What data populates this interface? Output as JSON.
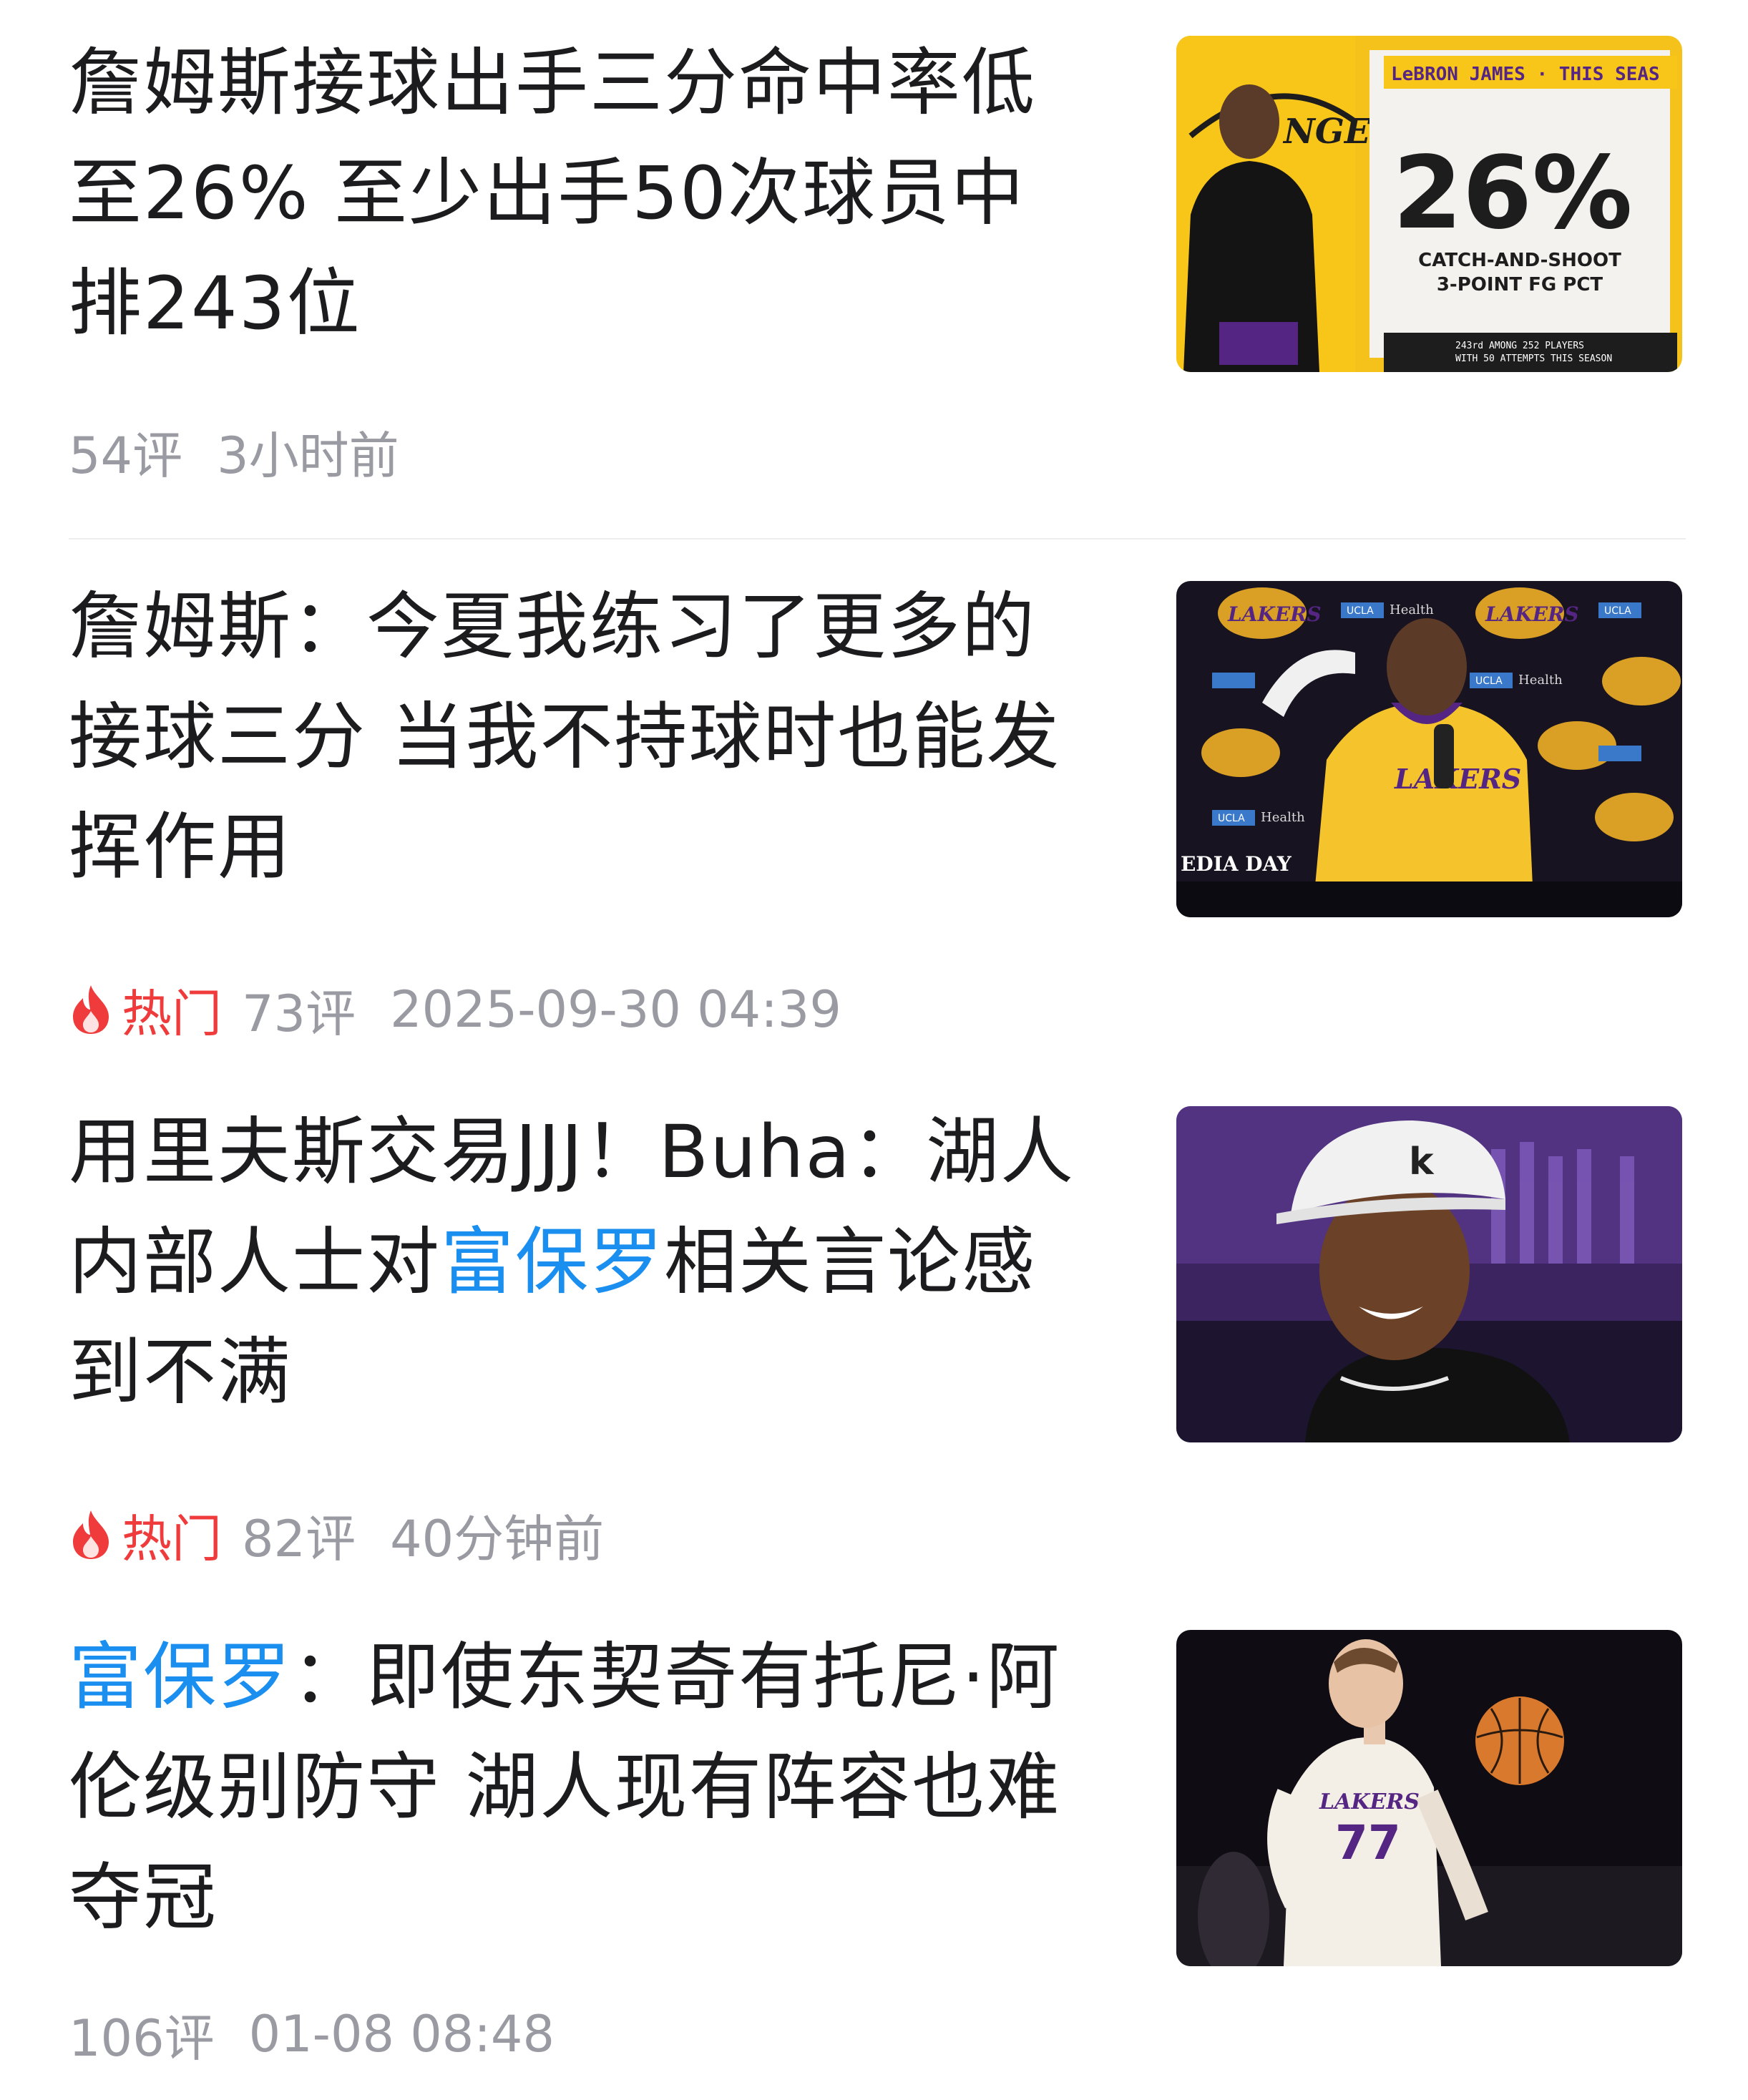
{
  "articles": [
    {
      "title_parts": [
        "詹姆斯接球出手三分命中率低至26% 至少出手50次球员中排243位"
      ],
      "comments": "54评",
      "time": "3小时前",
      "hot": false,
      "thumb": {
        "icon": "lebron-stat-graphic",
        "header": "LeBRON JAMES · THIS SEAS",
        "stat": "26%",
        "caption1": "CATCH-AND-SHOOT",
        "caption2": "3-POINT FG PCT",
        "footnote1": "243rd AMONG 252 PLAYERS",
        "footnote2": "WITH 50 ATTEMPTS THIS SEASON",
        "bg_text": "NGE"
      }
    },
    {
      "title_parts": [
        "詹姆斯：今夏我练习了更多的接球三分 当我不持球时也能发挥作用"
      ],
      "comments": "73评",
      "time": "2025-09-30 04:39",
      "hot": true,
      "hot_label": "热门",
      "thumb": {
        "icon": "media-day-photo",
        "logo_text": "LAKERS",
        "sponsor": "UCLA",
        "sponsor_sub": "Health",
        "jersey_text": "LAKERS",
        "footer_text": "EDIA DAY"
      }
    },
    {
      "title_parts": [
        "用里夫斯交易JJJ！Buha：湖人内部人士对",
        "富保罗",
        "相关言论感到不满"
      ],
      "highlight_index": 1,
      "comments": "82评",
      "time": "40分钟前",
      "hot": true,
      "hot_label": "热门",
      "thumb": {
        "icon": "courtside-portrait-photo",
        "cap_letter": "k"
      }
    },
    {
      "title_parts": [
        "",
        "富保罗",
        "：即使东契奇有托尼·阿伦级别防守 湖人现有阵容也难夺冠"
      ],
      "highlight_index": 1,
      "comments": "106评",
      "time": "01-08 08:48",
      "hot": false,
      "thumb": {
        "icon": "player-dribbling-photo",
        "jersey_text": "LAKERS",
        "number": "77"
      }
    }
  ],
  "colors": {
    "highlight": "#1a8ff0",
    "hot": "#ef3b3b",
    "meta": "#9a9aa2",
    "lakers_gold": "#fdb927",
    "lakers_purple": "#552583"
  }
}
